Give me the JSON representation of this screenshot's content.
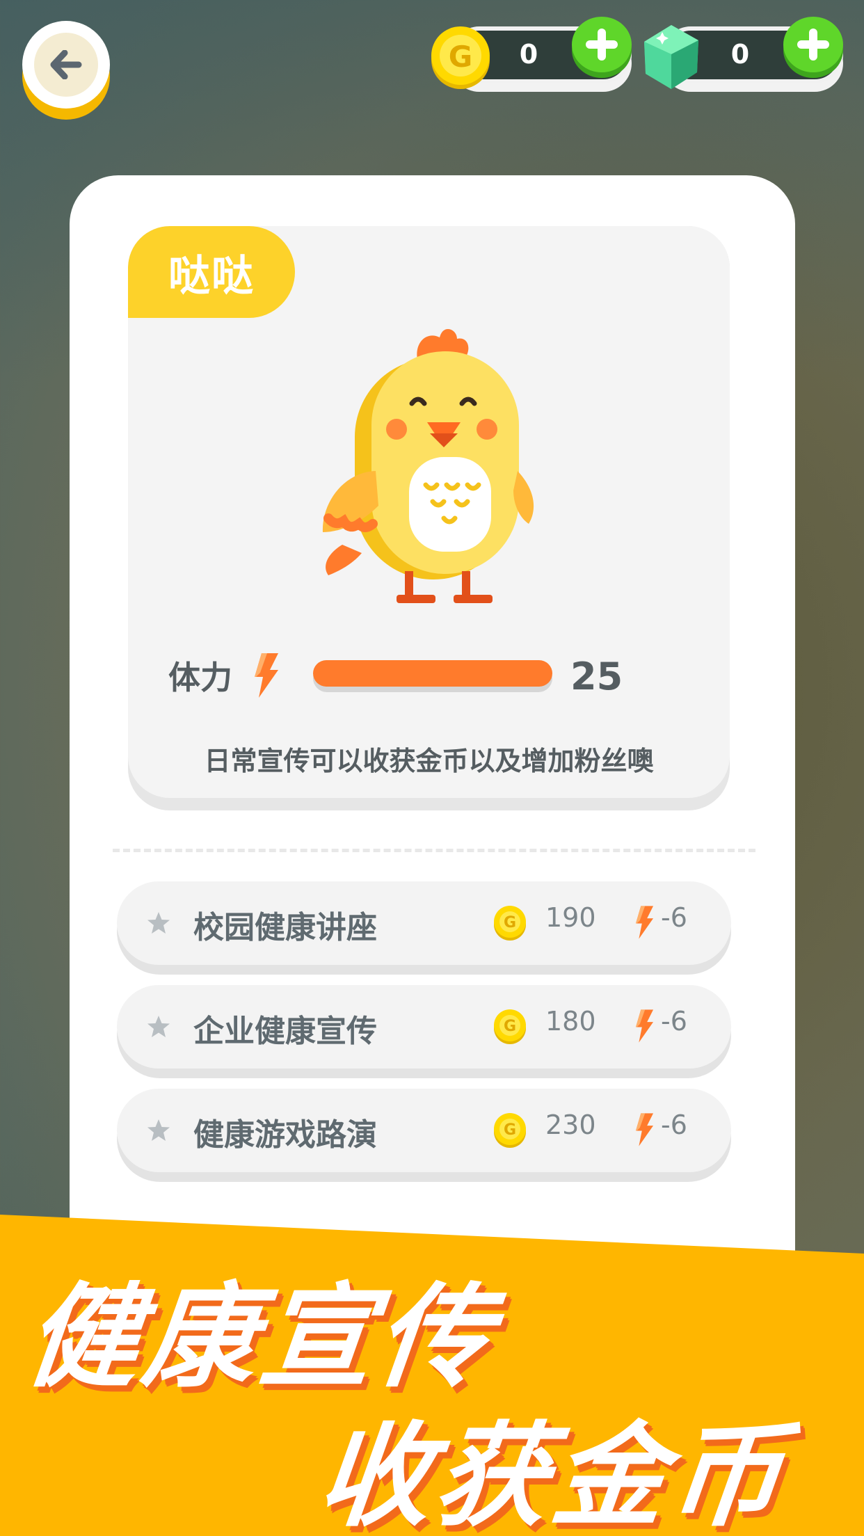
{
  "header": {
    "coins": "0",
    "gems": "0"
  },
  "pet": {
    "name": "哒哒",
    "stamina_label": "体力",
    "stamina_value": "25",
    "stamina_fraction": 1.0,
    "description": "日常宣传可以收获金币以及增加粉丝噢"
  },
  "tasks": [
    {
      "name": "校园健康讲座",
      "gold": "190",
      "cost": "-6"
    },
    {
      "name": "企业健康宣传",
      "gold": "180",
      "cost": "-6"
    },
    {
      "name": "健康游戏路演",
      "gold": "230",
      "cost": "-6"
    }
  ],
  "banner": {
    "line1": "健康宣传",
    "line2": "收获金币"
  },
  "colors": {
    "accent_yellow": "#fdd22a",
    "stamina_orange": "#ff7b2c",
    "plus_green": "#5fd62a",
    "banner_orange": "#ffb600"
  }
}
